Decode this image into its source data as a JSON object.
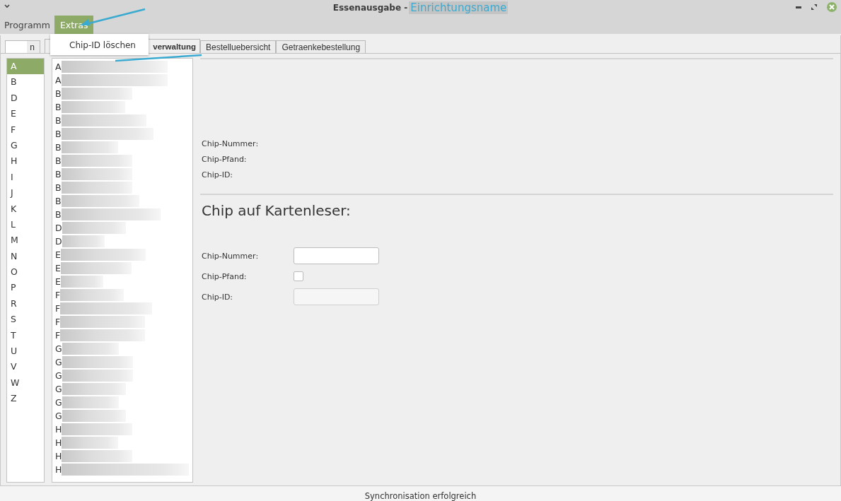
{
  "window": {
    "title": "Essenausgabe -",
    "annotation": "Einrichtungsname"
  },
  "menu": [
    {
      "label": "Programm",
      "selected": false
    },
    {
      "label": "Extras",
      "selected": true
    }
  ],
  "dropdown": [
    {
      "label": "Chip-ID löschen"
    }
  ],
  "tabs": [
    {
      "label": "n",
      "selected": false
    },
    {
      "label": "verwaltung",
      "selected": true
    },
    {
      "label": "Bestelluebersicht",
      "selected": false
    },
    {
      "label": "Getraenkebestellung",
      "selected": false
    }
  ],
  "letters": [
    {
      "label": "A",
      "selected": true
    },
    {
      "label": "B",
      "selected": false
    },
    {
      "label": "D",
      "selected": false
    },
    {
      "label": "E",
      "selected": false
    },
    {
      "label": "F",
      "selected": false
    },
    {
      "label": "G",
      "selected": false
    },
    {
      "label": "H",
      "selected": false
    },
    {
      "label": "I",
      "selected": false
    },
    {
      "label": "J",
      "selected": false
    },
    {
      "label": "K",
      "selected": false
    },
    {
      "label": "L",
      "selected": false
    },
    {
      "label": "M",
      "selected": false
    },
    {
      "label": "N",
      "selected": false
    },
    {
      "label": "O",
      "selected": false
    },
    {
      "label": "P",
      "selected": false
    },
    {
      "label": "R",
      "selected": false
    },
    {
      "label": "S",
      "selected": false
    },
    {
      "label": "T",
      "selected": false
    },
    {
      "label": "U",
      "selected": false
    },
    {
      "label": "V",
      "selected": false
    },
    {
      "label": "W",
      "selected": false
    },
    {
      "label": "Z",
      "selected": false
    }
  ],
  "names": [
    "A",
    "A",
    "B",
    "B",
    "B",
    "B",
    "B",
    "B",
    "B",
    "B",
    "B",
    "B",
    "D",
    "D",
    "E",
    "E",
    "E",
    "F",
    "F",
    "F",
    "F",
    "G",
    "G",
    "G",
    "G",
    "G",
    "G",
    "H",
    "H",
    "H",
    "H"
  ],
  "chip_info": {
    "labels": [
      "Chip-Nummer:",
      "Chip-Pfand:",
      "Chip-ID:"
    ]
  },
  "reader": {
    "heading": "Chip auf Kartenleser:",
    "number_label": "Chip-Nummer:",
    "deposit_label": "Chip-Pfand:",
    "deposit_checked": false,
    "id_label": "Chip-ID:",
    "id_disabled": true
  },
  "status_bar": "Synchronisation erfolgreich"
}
